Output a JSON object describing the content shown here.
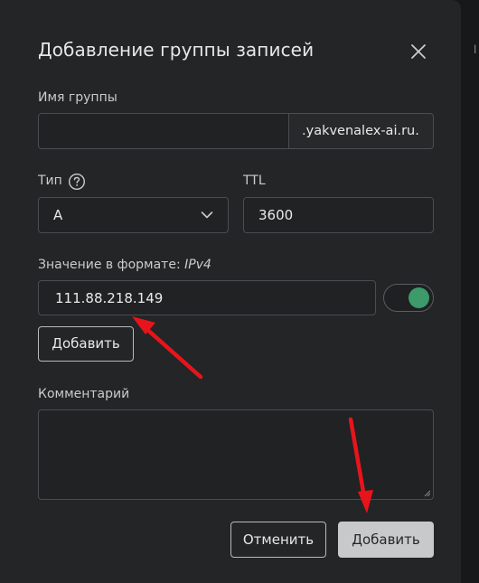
{
  "dialog": {
    "title": "Добавление группы записей"
  },
  "group_name": {
    "label": "Имя группы",
    "value": "",
    "domain_suffix": ".yakvenalex-ai.ru."
  },
  "type": {
    "label": "Тип",
    "value": "A"
  },
  "ttl": {
    "label": "TTL",
    "value": "3600"
  },
  "value_field": {
    "label_prefix": "Значение в формате:",
    "label_format": "IPv4",
    "value": "111.88.218.149",
    "toggle_on": true,
    "add_label": "Добавить"
  },
  "comment": {
    "label": "Комментарий",
    "value": ""
  },
  "footer": {
    "cancel_label": "Отменить",
    "submit_label": "Добавить"
  },
  "colors": {
    "dialog_bg": "#232527",
    "toggle_on": "#3d9a6a",
    "annotation_arrow": "#e8141b"
  },
  "icons": {
    "close": "close-icon",
    "help": "question-circle-icon",
    "dropdown": "chevron-down-icon"
  }
}
